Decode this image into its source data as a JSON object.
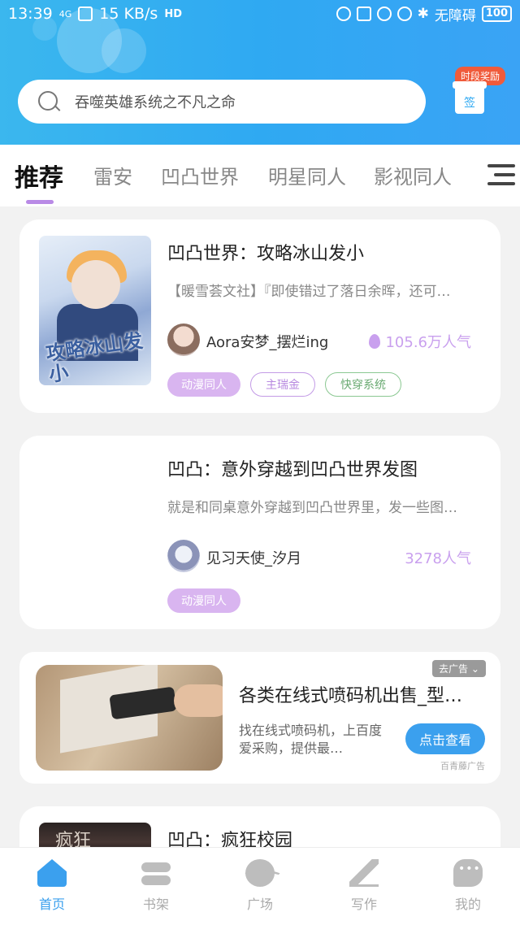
{
  "status_bar": {
    "time": "13:39",
    "network": "4G",
    "speed": "15 KB/s",
    "hd": "HD",
    "accessibility": "无障碍",
    "battery": "100"
  },
  "search": {
    "placeholder": "吞噬英雄系统之不凡之命"
  },
  "reward": {
    "badge": "时段奖励",
    "sign": "签"
  },
  "tabs": [
    {
      "label": "推荐",
      "active": true
    },
    {
      "label": "雷安"
    },
    {
      "label": "凹凸世界"
    },
    {
      "label": "明星同人"
    },
    {
      "label": "影视同人"
    }
  ],
  "feed": [
    {
      "title": "凹凸世界：攻略冰山发小",
      "desc": "【暖雪荟文社】『即使错过了落日余晖，还可…",
      "cover_text": "攻略冰山发小",
      "author": "Aora安梦_摆烂ing",
      "popularity": "105.6万人气",
      "tags": [
        "动漫同人",
        "主瑞金",
        "快穿系统"
      ]
    },
    {
      "title": "凹凸：意外穿越到凹凸世界发图",
      "desc": "就是和同桌意外穿越到凹凸世界里，发一些图…",
      "author": "见习天使_汐月",
      "popularity": "3278人气",
      "tags": [
        "动漫同人"
      ]
    },
    {
      "title": "凹凸：疯狂校园",
      "cover_text": "疯狂"
    }
  ],
  "ad": {
    "close_label": "去广告",
    "title": "各类在线式喷码机出售_型…",
    "desc": "找在线式喷码机，上百度爱采购，提供最…",
    "button": "点击查看",
    "source": "百青藤广告"
  },
  "bottom_nav": [
    {
      "label": "首页",
      "icon": "home-icon",
      "active": true
    },
    {
      "label": "书架",
      "icon": "bookshelf-icon"
    },
    {
      "label": "广场",
      "icon": "planet-icon"
    },
    {
      "label": "写作",
      "icon": "pen-icon"
    },
    {
      "label": "我的",
      "icon": "chat-bubble-icon"
    }
  ],
  "colors": {
    "header_blue": "#2fa9f2",
    "accent_purple": "#c9a0ee",
    "ad_button_blue": "#3ba0ee"
  }
}
